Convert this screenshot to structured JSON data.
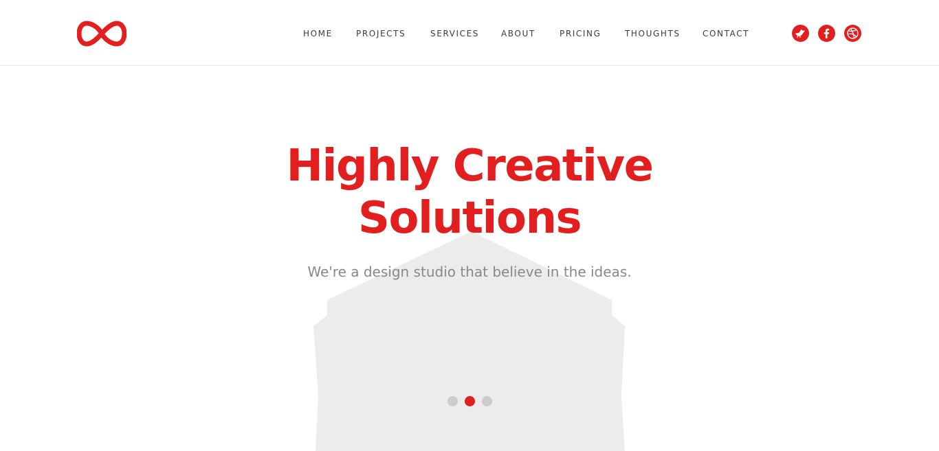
{
  "brand": {
    "logo_icon": "infinity-logo-icon",
    "accent_color": "#e31e1e"
  },
  "nav": {
    "items": [
      {
        "label": "HOME"
      },
      {
        "label": "PROJECTS"
      },
      {
        "label": "SERVICES"
      },
      {
        "label": "ABOUT"
      },
      {
        "label": "PRICING"
      },
      {
        "label": "THOUGHTS"
      },
      {
        "label": "CONTACT"
      }
    ]
  },
  "social": [
    {
      "icon": "twitter-bird-icon"
    },
    {
      "icon": "facebook-icon"
    },
    {
      "icon": "dribbble-icon"
    }
  ],
  "hero": {
    "title_line1": "Highly Creative",
    "title_line2": "Solutions",
    "subtitle": "We're a design studio that believe in the ideas.",
    "background_color": "#ececec",
    "slider": {
      "count": 3,
      "active_index": 1
    }
  }
}
